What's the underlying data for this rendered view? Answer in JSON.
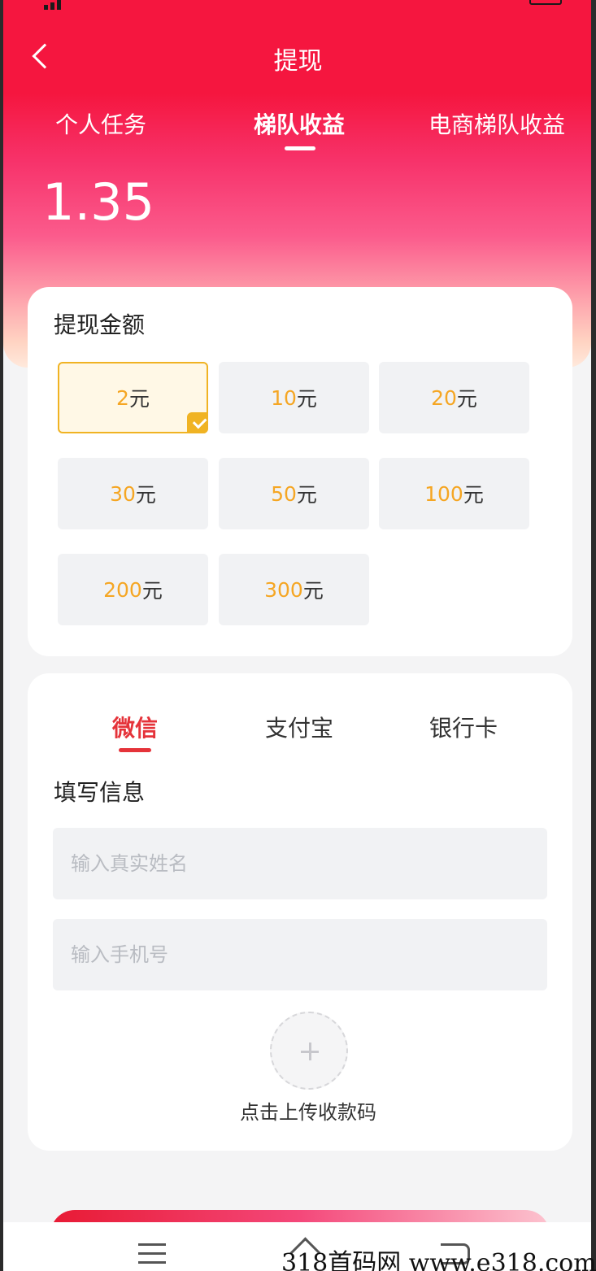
{
  "header": {
    "title": "提现"
  },
  "top_tabs": [
    "个人任务",
    "梯队收益",
    "电商梯队收益"
  ],
  "active_top_tab": 1,
  "balance": "1.35",
  "amount_section": {
    "title": "提现金额",
    "unit": "元",
    "options": [
      "2",
      "10",
      "20",
      "30",
      "50",
      "100",
      "200",
      "300"
    ],
    "selected_index": 0
  },
  "payment_tabs": [
    "微信",
    "支付宝",
    "银行卡"
  ],
  "active_payment_tab": 0,
  "info_section": {
    "title": "填写信息",
    "name_placeholder": "输入真实姓名",
    "phone_placeholder": "输入手机号",
    "upload_label": "点击上传收款码"
  },
  "watermark": "318首码网  www.e318.com",
  "colors": {
    "primary_red": "#f5163f",
    "accent_gold": "#f5a623",
    "tab_active_red": "#e5333a"
  }
}
